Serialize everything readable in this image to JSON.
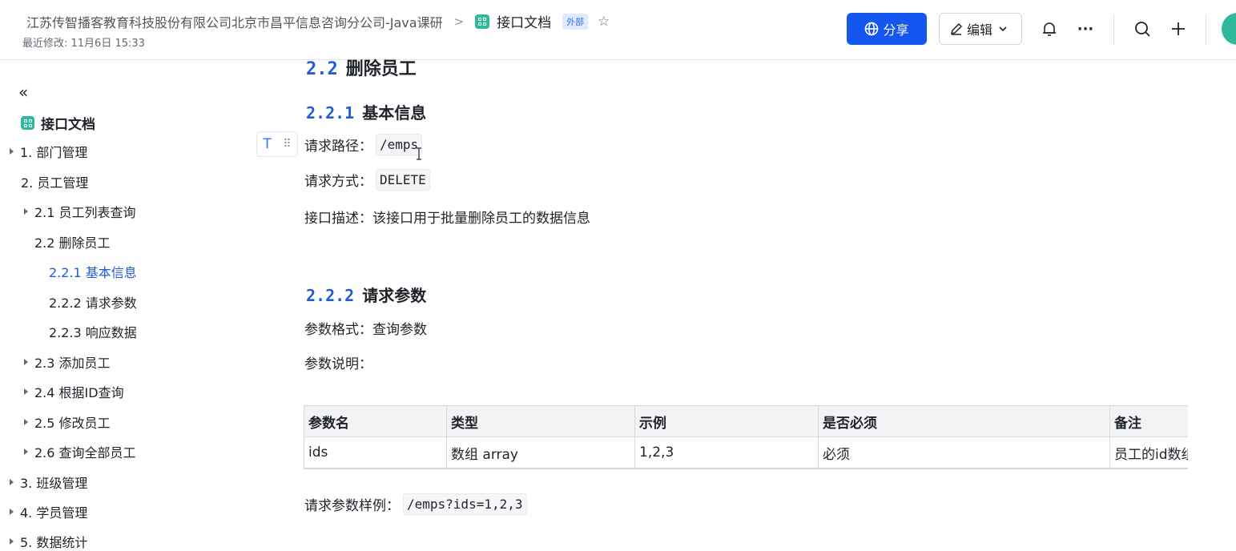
{
  "header": {
    "breadcrumb": "江苏传智播客教育科技股份有限公司北京市昌平信息咨询分公司-Java课研",
    "separator": ">",
    "doc_title": "接口文档",
    "badge": "外部",
    "last_modified": "最近修改: 11月6日 15:33",
    "share_label": "分享",
    "edit_label": "编辑",
    "more_label": "···",
    "accent_color": "#1456f0"
  },
  "sidebar": {
    "collapse_icon": "«",
    "title": "接口文档",
    "items": [
      {
        "label": "1. 部门管理"
      },
      {
        "label": "2. 员工管理"
      },
      {
        "label": "2.1 员工列表查询"
      },
      {
        "label": "2.2 删除员工"
      },
      {
        "label": "2.2.1 基本信息"
      },
      {
        "label": "2.2.2 请求参数"
      },
      {
        "label": "2.2.3 响应数据"
      },
      {
        "label": "2.3 添加员工"
      },
      {
        "label": "2.4 根据ID查询"
      },
      {
        "label": "2.5 修改员工"
      },
      {
        "label": "2.6 查询全部员工"
      },
      {
        "label": "3. 班级管理"
      },
      {
        "label": "4. 学员管理"
      },
      {
        "label": "5. 数据统计"
      }
    ]
  },
  "content": {
    "h2_num": "2.2",
    "h2_text": "删除员工",
    "section1": {
      "num": "2.2.1",
      "text": "基本信息"
    },
    "path_label": "请求路径：",
    "path_value": "/emps",
    "method_label": "请求方式：",
    "method_value": "DELETE",
    "desc": "接口描述：该接口用于批量删除员工的数据信息",
    "section2": {
      "num": "2.2.2",
      "text": "请求参数"
    },
    "param_format": "参数格式：查询参数",
    "param_desc": "参数说明：",
    "table": {
      "headers": [
        "参数名",
        "类型",
        "示例",
        "是否必须",
        "备注"
      ],
      "row": [
        "ids",
        "数组 array",
        "1,2,3",
        "必须",
        "员工的id数组"
      ]
    },
    "example_label": "请求参数样例：",
    "example_value": "/emps?ids=1,2,3"
  }
}
